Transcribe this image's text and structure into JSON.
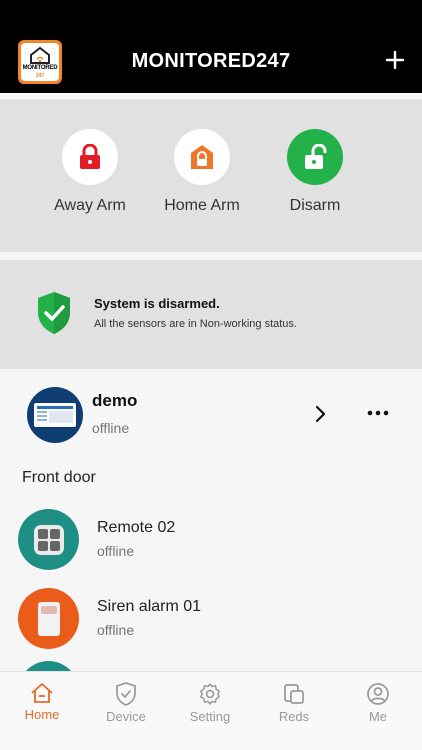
{
  "app": {
    "title": "MONITORED247",
    "logo_text": "MONITORED",
    "logo_sub": "247"
  },
  "colors": {
    "accent": "#e56a2c",
    "away_red": "#e01d24",
    "home_orange": "#f0772a",
    "disarm_green": "#25b14a",
    "teal": "#1f8f86",
    "orange": "#ea5c19"
  },
  "arm_modes": [
    {
      "label": "Away Arm",
      "icon": "lock-closed-icon"
    },
    {
      "label": "Home Arm",
      "icon": "home-lock-icon"
    },
    {
      "label": "Disarm",
      "icon": "lock-open-icon"
    }
  ],
  "status": {
    "title": "System is disarmed.",
    "subtitle": "All the sensors are in Non-working status."
  },
  "hub": {
    "name": "demo",
    "state": "offline"
  },
  "group": {
    "label": "Front door"
  },
  "devices": [
    {
      "name": "Remote 02",
      "state": "offline",
      "icon": "remote-icon"
    },
    {
      "name": "Siren alarm 01",
      "state": "offline",
      "icon": "siren-icon"
    }
  ],
  "tabs": [
    {
      "label": "Home",
      "icon": "home-icon",
      "active": true
    },
    {
      "label": "Device",
      "icon": "shield-icon",
      "active": false
    },
    {
      "label": "Setting",
      "icon": "gear-icon",
      "active": false
    },
    {
      "label": "Reds",
      "icon": "records-icon",
      "active": false
    },
    {
      "label": "Me",
      "icon": "user-icon",
      "active": false
    }
  ]
}
